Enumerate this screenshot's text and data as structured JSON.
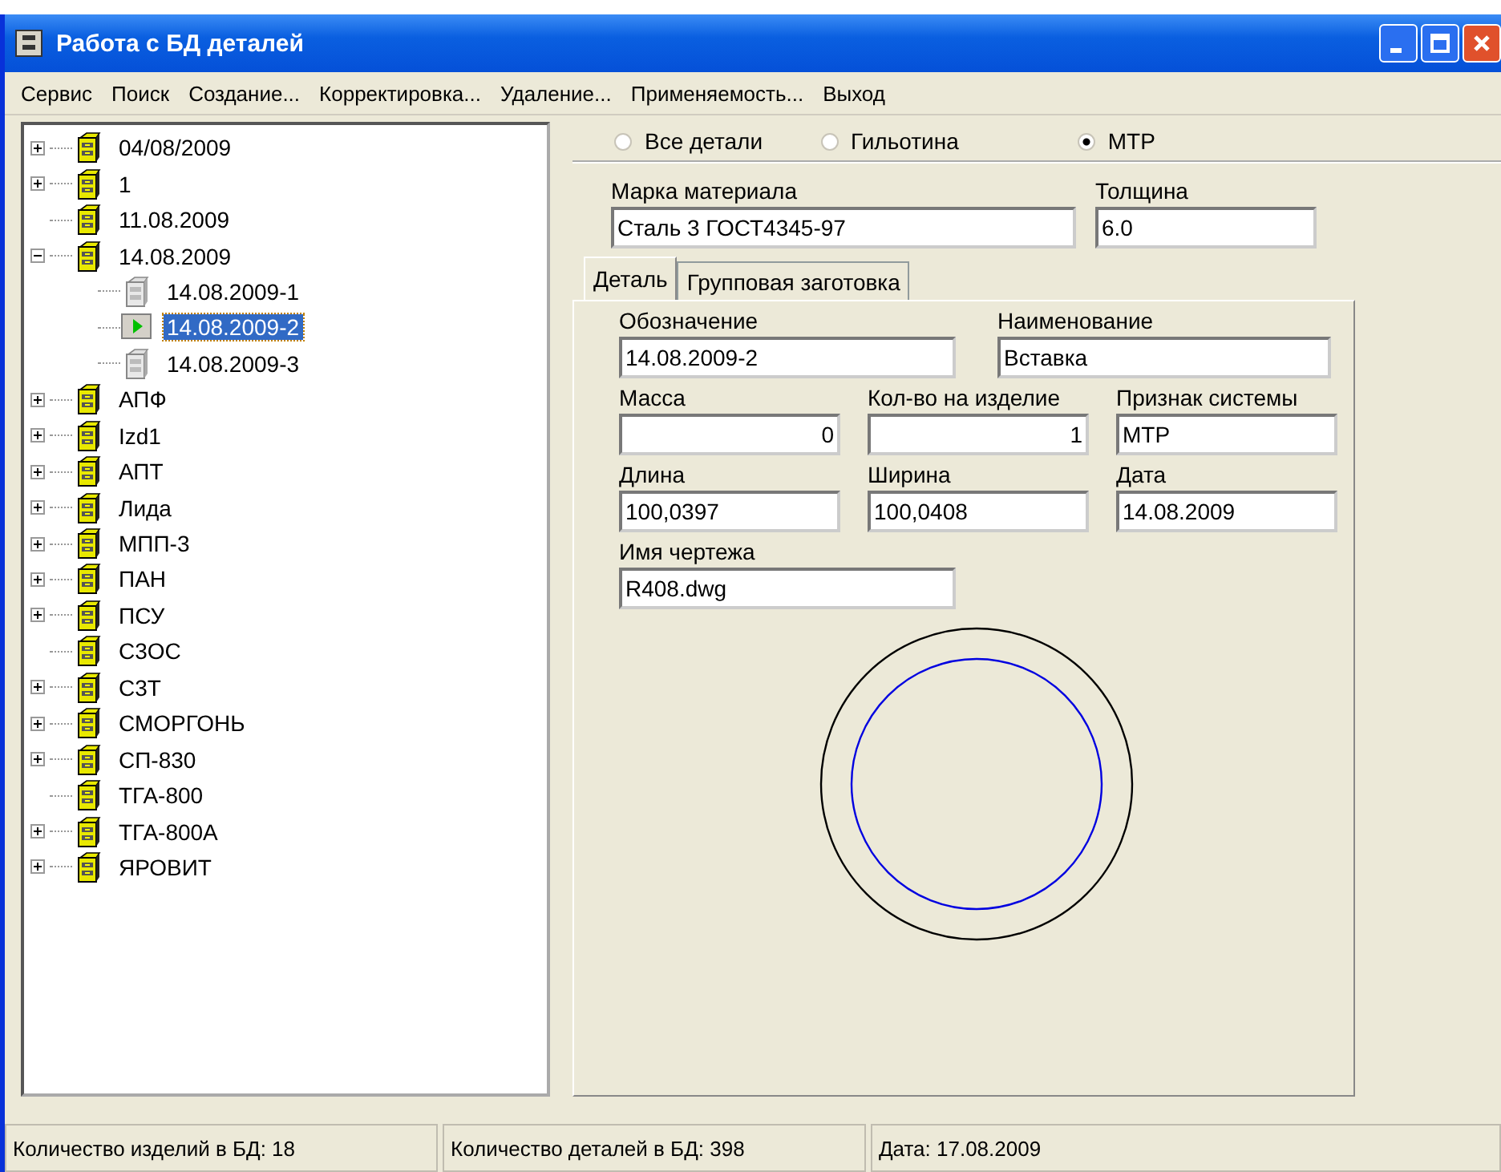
{
  "window": {
    "title": "Работа с БД деталей"
  },
  "menu": [
    "Сервис",
    "Поиск",
    "Создание...",
    "Корректировка...",
    "Удаление...",
    "Применяемость...",
    "Выход"
  ],
  "tree": [
    {
      "label": "04/08/2009",
      "kind": "folder",
      "expanded": false,
      "selected": false
    },
    {
      "label": "1",
      "kind": "folder",
      "expanded": false,
      "selected": false
    },
    {
      "label": "11.08.2009",
      "kind": "folder",
      "selected": false
    },
    {
      "label": "14.08.2009",
      "kind": "folder",
      "expanded": true,
      "selected": false,
      "children": [
        {
          "label": "14.08.2009-1",
          "kind": "part",
          "selected": false
        },
        {
          "label": "14.08.2009-2",
          "kind": "current",
          "selected": true
        },
        {
          "label": "14.08.2009-3",
          "kind": "part",
          "selected": false
        }
      ]
    },
    {
      "label": "АПФ",
      "kind": "folder",
      "expanded": false,
      "selected": false
    },
    {
      "label": "Izd1",
      "kind": "folder",
      "expanded": false,
      "selected": false
    },
    {
      "label": "АПТ",
      "kind": "folder",
      "expanded": false,
      "selected": false
    },
    {
      "label": "Лида",
      "kind": "folder",
      "expanded": false,
      "selected": false
    },
    {
      "label": "МПП-3",
      "kind": "folder",
      "expanded": false,
      "selected": false
    },
    {
      "label": "ПАН",
      "kind": "folder",
      "expanded": false,
      "selected": false
    },
    {
      "label": "ПСУ",
      "kind": "folder",
      "expanded": false,
      "selected": false
    },
    {
      "label": "С3ОС",
      "kind": "folder",
      "selected": false
    },
    {
      "label": "С3Т",
      "kind": "folder",
      "expanded": false,
      "selected": false
    },
    {
      "label": "СМОРГОНЬ",
      "kind": "folder",
      "expanded": false,
      "selected": false
    },
    {
      "label": "СП-830",
      "kind": "folder",
      "expanded": false,
      "selected": false
    },
    {
      "label": "ТГА-800",
      "kind": "folder",
      "selected": false
    },
    {
      "label": "ТГА-800А",
      "kind": "folder",
      "expanded": false,
      "selected": false
    },
    {
      "label": "ЯРОВИТ",
      "kind": "folder",
      "expanded": false,
      "selected": false
    }
  ],
  "filter": [
    {
      "label": "Все детали",
      "selected": false
    },
    {
      "label": "Гильотина",
      "selected": false
    },
    {
      "label": "МТР",
      "selected": true
    }
  ],
  "material": {
    "label": "Марка материала",
    "value": "Сталь 3 ГОСТ4345-97"
  },
  "thickness": {
    "label": "Толщина",
    "value": "6.0"
  },
  "tabs": [
    {
      "label": "Деталь",
      "selected": true
    },
    {
      "label": "Групповая заготовка",
      "selected": false
    }
  ],
  "fields": [
    [
      {
        "label": "Обозначение",
        "value": "14.08.2009-2"
      },
      {
        "label": "Наименование",
        "value": "Вставка"
      }
    ],
    [
      {
        "label": "Масса",
        "value": "0"
      },
      {
        "label": "Кол-во на изделие",
        "value": "1"
      },
      {
        "label": "Признак системы",
        "value": "МТР"
      }
    ],
    [
      {
        "label": "Длина",
        "value": "100,0397"
      },
      {
        "label": "Ширина",
        "value": "100,0408"
      },
      {
        "label": "Дата",
        "value": "14.08.2009"
      }
    ],
    [
      {
        "label": "Имя чертежа",
        "value": "R408.dwg"
      }
    ]
  ],
  "status_bar": [
    "Количество изделий в БД: 18",
    "Количество деталей в БД: 398",
    "Дата: 17.08.2009"
  ]
}
